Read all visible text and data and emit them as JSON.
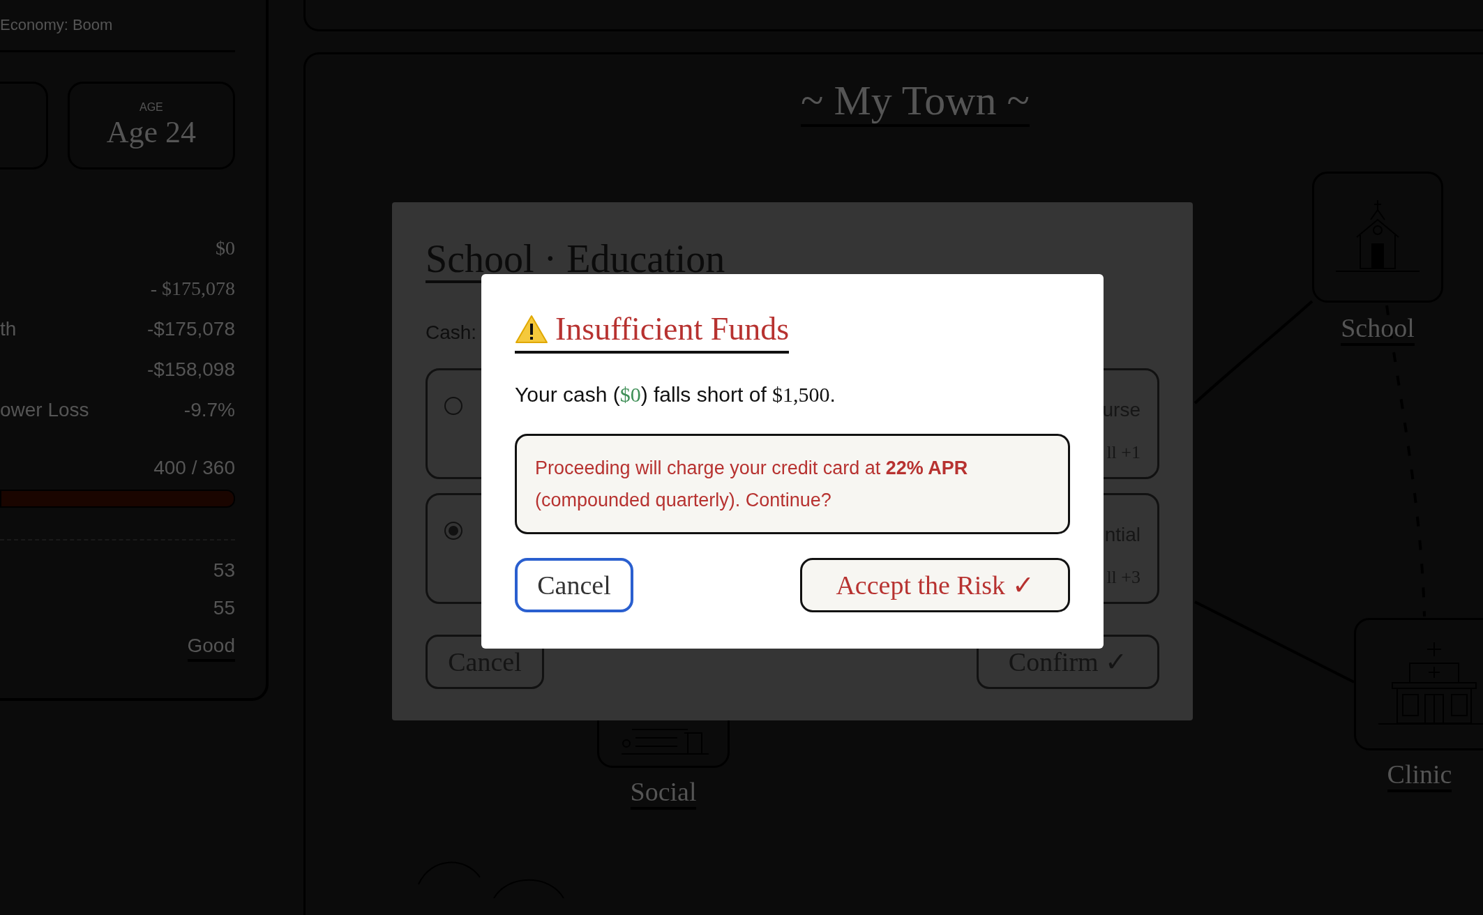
{
  "sidebar": {
    "subtitle": "Economy: Boom",
    "stat_cards": [
      {
        "kind": "blank"
      },
      {
        "kind": "value",
        "label": "AGE",
        "value": "Age 24"
      }
    ],
    "rows": [
      {
        "value": "$0",
        "kind": "serif"
      },
      {
        "value": "- $175,078",
        "kind": "serif"
      },
      {
        "label": "th",
        "value": "-$175,078",
        "kind": "sans"
      },
      {
        "value": "-$158,098",
        "kind": "sans"
      },
      {
        "label": "ower Loss",
        "value": "-9.7%",
        "kind": "sans"
      }
    ],
    "meter": {
      "reading": "400 / 360",
      "level": 1
    },
    "scores": [
      {
        "value": "53",
        "underlined": false
      },
      {
        "value": "55",
        "underlined": false
      },
      {
        "value": "Good",
        "underlined": true
      }
    ]
  },
  "map": {
    "title": "~ My Town ~",
    "nodes": [
      {
        "kind": "school",
        "label": "School"
      },
      {
        "kind": "clinic",
        "label": "Clinic"
      },
      {
        "kind": "social",
        "label": "Social"
      }
    ]
  },
  "education_dialog": {
    "title": "School · Education",
    "cash_label": "Cash:",
    "options": [
      {
        "selected": false,
        "name": "urse",
        "detail": "ll +1"
      },
      {
        "selected": true,
        "name": "ntial",
        "detail": "ll +3"
      }
    ],
    "buttons": [
      {
        "kind": "cancel",
        "label": "Cancel"
      },
      {
        "kind": "confirm",
        "label": "Confirm ✓"
      }
    ]
  },
  "alert": {
    "title": "Insufficient Funds",
    "message": {
      "before": "Your cash (",
      "cash": "$0",
      "middle": ") falls short of ",
      "cost": "$1,500",
      "after": "."
    },
    "warning": "Proceeding will charge your credit card at **22% APR** (compounded quarterly). Continue?",
    "buttons": [
      {
        "kind": "cancel",
        "label": "Cancel",
        "focused": true
      },
      {
        "kind": "accept",
        "label": "Accept the Risk ✓",
        "focused": false
      }
    ]
  }
}
